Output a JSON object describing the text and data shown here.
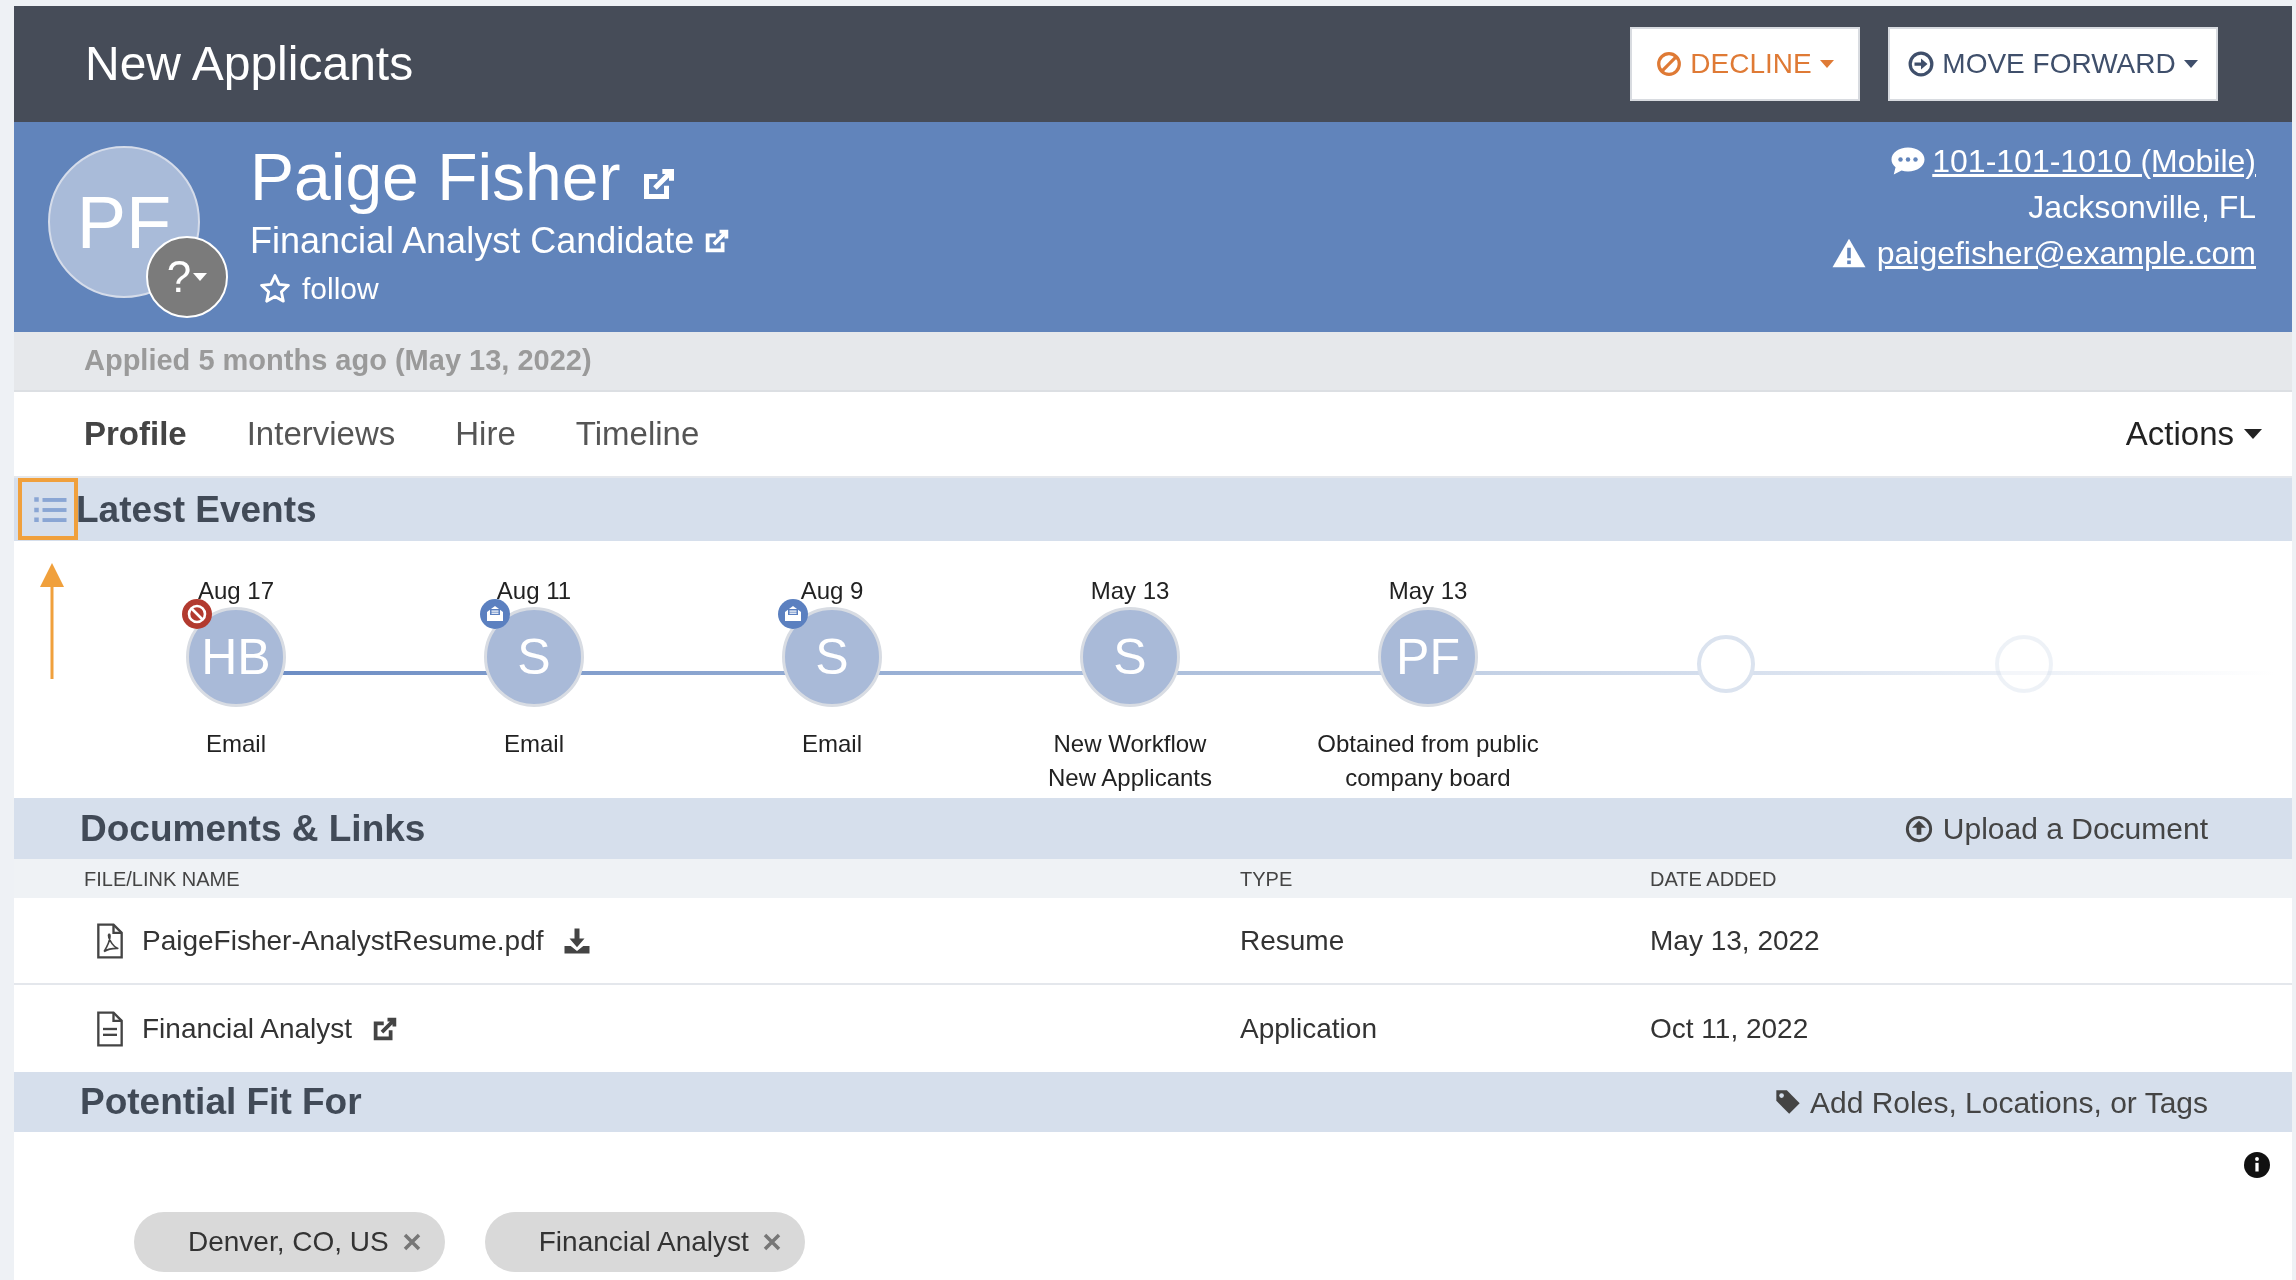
{
  "header": {
    "title": "New Applicants",
    "buttons": [
      {
        "kind": "decline",
        "label": "DECLINE"
      },
      {
        "kind": "forward",
        "label": "MOVE FORWARD"
      }
    ]
  },
  "candidate": {
    "initials": "PF",
    "status_badge": "?",
    "name": "Paige Fisher",
    "headline": "Financial Analyst Candidate",
    "follow": "follow",
    "phone": "101-101-1010 (Mobile)",
    "location": "Jacksonville, FL",
    "email": "paigefisher@example.com"
  },
  "applied": "Applied 5 months ago (May 13, 2022)",
  "tabs": [
    {
      "label": "Profile",
      "selected": true
    },
    {
      "label": "Interviews",
      "selected": false
    },
    {
      "label": "Hire",
      "selected": false
    },
    {
      "label": "Timeline",
      "selected": false
    }
  ],
  "actions": "Actions",
  "latest_events": {
    "title": "Latest Events",
    "events": [
      {
        "kind": "event",
        "date": "Aug 17",
        "initials": "HB",
        "badge": {
          "kind": "declined"
        },
        "label_lines": [
          "Email"
        ]
      },
      {
        "kind": "event",
        "date": "Aug 11",
        "initials": "S",
        "badge": {
          "kind": "message"
        },
        "label_lines": [
          "Email"
        ]
      },
      {
        "kind": "event",
        "date": "Aug 9",
        "initials": "S",
        "badge": {
          "kind": "message"
        },
        "label_lines": [
          "Email"
        ]
      },
      {
        "kind": "event",
        "date": "May 13",
        "initials": "S",
        "label_lines": [
          "New Workflow",
          "New Applicants"
        ]
      },
      {
        "kind": "event",
        "date": "May 13",
        "initials": "PF",
        "label_lines": [
          "Obtained from public",
          "company board"
        ]
      },
      {
        "kind": "placeholder"
      },
      {
        "kind": "placeholder"
      }
    ]
  },
  "documents": {
    "title": "Documents & Links",
    "upload": "Upload a Document",
    "columns": [
      "FILE/LINK NAME",
      "TYPE",
      "DATE ADDED"
    ],
    "rows": [
      {
        "kind": "file",
        "name": "PaigeFisher-AnalystResume.pdf",
        "type": "Resume",
        "date_added": "May 13, 2022"
      },
      {
        "kind": "link",
        "name": "Financial Analyst",
        "type": "Application",
        "date_added": "Oct 11, 2022"
      }
    ]
  },
  "potential_fit": {
    "title": "Potential Fit For",
    "add": "Add Roles, Locations, or Tags",
    "tags": [
      "Denver, CO, US",
      "Financial Analyst"
    ]
  }
}
